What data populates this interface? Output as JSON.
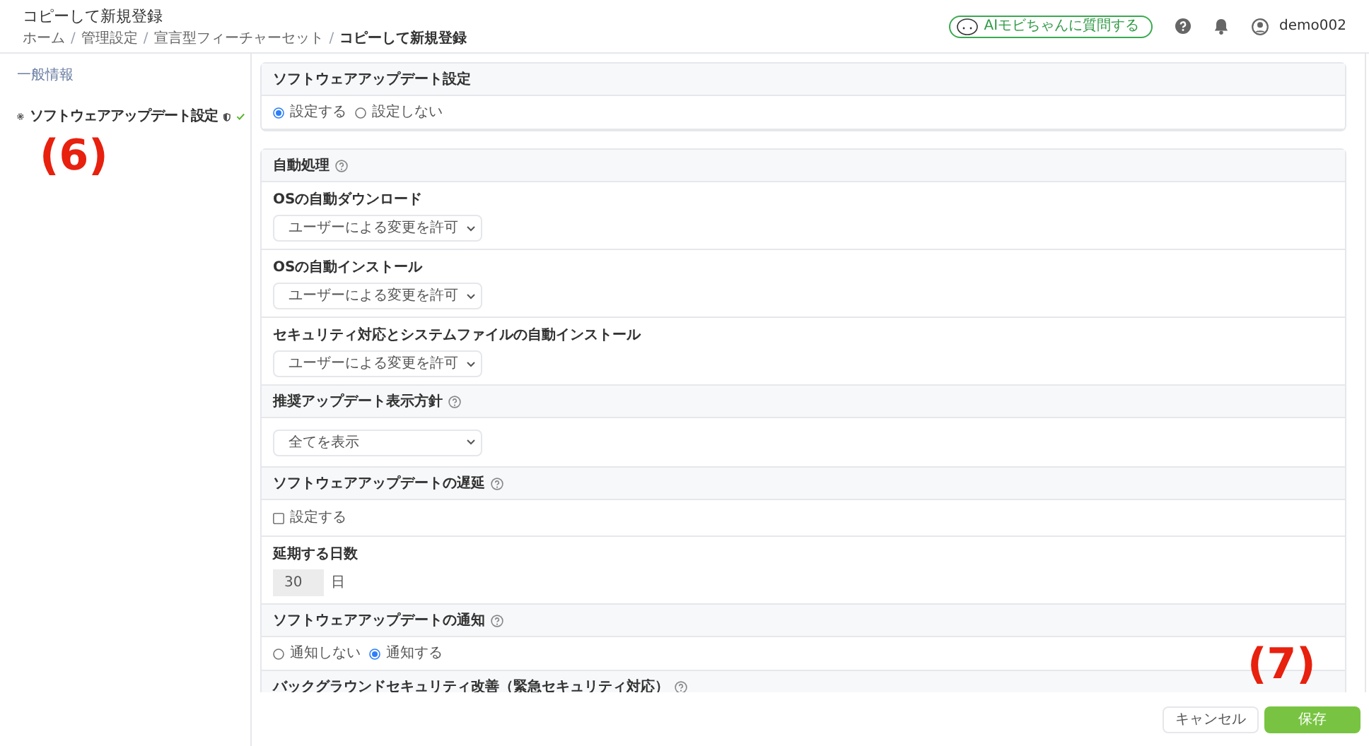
{
  "header": {
    "title": "コピーして新規登録",
    "breadcrumb": [
      {
        "label": "ホーム"
      },
      {
        "separator": "/",
        "label": "管理設定"
      },
      {
        "separator": "/",
        "label": "宣言型フィーチャーセット"
      },
      {
        "separator": "/",
        "label": "コピーして新規登録"
      }
    ],
    "ai_button": "AIモビちゃんに質問する",
    "user": "demo002"
  },
  "sidebar": {
    "section": "一般情報",
    "items": [
      {
        "label": "ソフトウェアアップデート設定",
        "done": true
      }
    ]
  },
  "cards": [
    {
      "rows": [
        {
          "kind": "header",
          "title": "ソフトウェアアップデート設定"
        },
        {
          "kind": "radio",
          "options": [
            {
              "label": "設定する",
              "selected": true
            },
            {
              "label": "設定しない",
              "selected": false
            }
          ]
        }
      ]
    },
    {
      "rows": [
        {
          "kind": "header",
          "title": "自動処理",
          "help": true
        },
        {
          "kind": "select",
          "label": "OSの自動ダウンロード",
          "value": "ユーザーによる変更を許可"
        },
        {
          "kind": "select",
          "label": "OSの自動インストール",
          "value": "ユーザーによる変更を許可"
        },
        {
          "kind": "select",
          "label": "セキュリティ対応とシステムファイルの自動インストール",
          "value": "ユーザーによる変更を許可"
        },
        {
          "kind": "header",
          "title": "推奨アップデート表示方針",
          "help": true
        },
        {
          "kind": "select",
          "value": "全てを表示"
        },
        {
          "kind": "header",
          "title": "ソフトウェアアップデートの遅延",
          "help": true
        },
        {
          "kind": "checkbox",
          "label": "設定する",
          "checked": false
        },
        {
          "kind": "number",
          "label": "延期する日数",
          "value": "30",
          "unit": "日"
        },
        {
          "kind": "header",
          "title": "ソフトウェアアップデートの通知",
          "help": true
        },
        {
          "kind": "radio",
          "options": [
            {
              "label": "通知しない",
              "selected": false
            },
            {
              "label": "通知する",
              "selected": true
            }
          ]
        },
        {
          "kind": "header",
          "title": "バックグラウンドセキュリティ改善（緊急セキュリティ対応）",
          "help": true
        }
      ]
    }
  ],
  "footer": {
    "cancel": "キャンセル",
    "save": "保存"
  },
  "annotations": [
    "(6)",
    "(7)"
  ]
}
